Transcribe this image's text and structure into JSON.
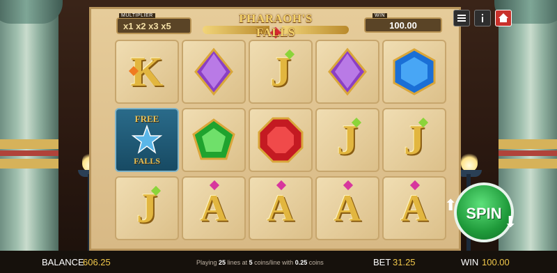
{
  "header": {
    "multiplier_label": "MULTIPLIER",
    "multipliers": "x1 x2 x3 x5",
    "title": "PHARAOH'S FALLS",
    "win_label": "WIN",
    "win_value": "100.00"
  },
  "controls": {
    "menu_icon": "menu-icon",
    "info_icon": "info-icon",
    "home_icon": "home-icon",
    "spin_label": "SPIN"
  },
  "reels": [
    [
      "K",
      "purple-diamond",
      "J",
      "purple-diamond",
      "blue-hexagon"
    ],
    [
      "FREE FALLS",
      "green-pentagon",
      "red-octagon",
      "J",
      "J"
    ],
    [
      "J",
      "A",
      "A",
      "A",
      "A"
    ]
  ],
  "free_symbol": {
    "top": "FREE",
    "bottom": "FALLS"
  },
  "footer": {
    "balance_label": "BALANCE",
    "balance_value": "606.25",
    "playing_prefix": "Playing",
    "lines": "25",
    "lines_mid": "lines at",
    "coins": "5",
    "coins_mid": "coins/line with",
    "coin_value": "0.25",
    "coins_suffix": "coins",
    "bet_label": "BET",
    "bet_value": "31.25",
    "win_label": "WIN",
    "win_value": "100.00"
  },
  "colors": {
    "spin": "#1f9a3a",
    "home": "#c9312b",
    "gold": "#f1c84b"
  }
}
